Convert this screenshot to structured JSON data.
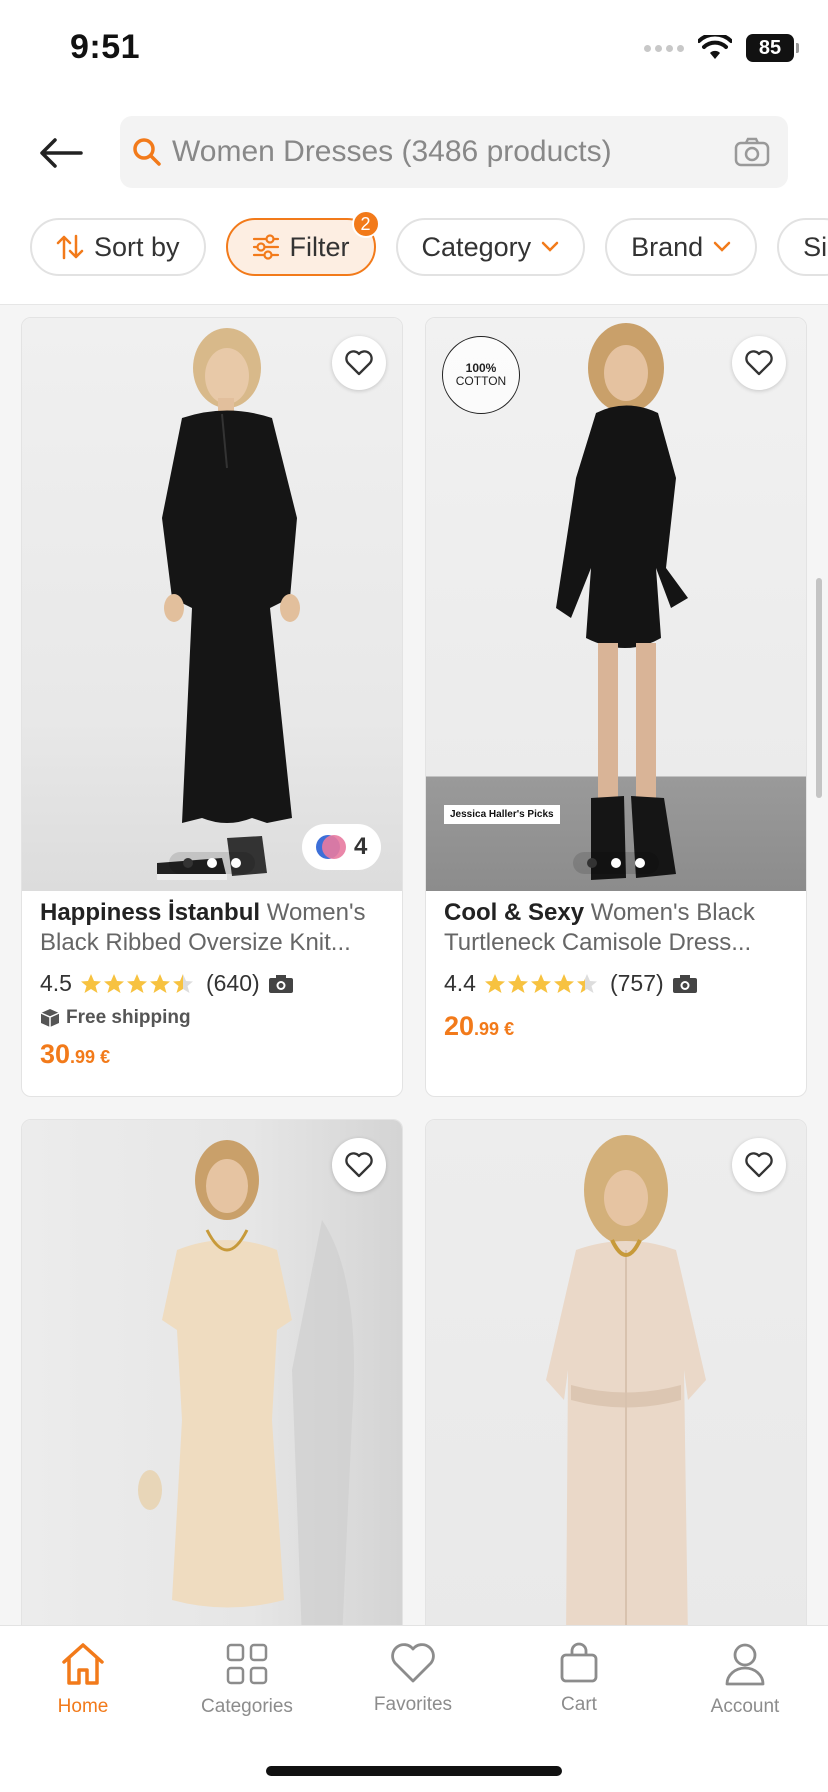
{
  "status_bar": {
    "time": "9:51",
    "battery": "85"
  },
  "header": {
    "search_text": "Women Dresses (3486 products)",
    "chips": [
      {
        "label": "Sort by",
        "icon": "sort-icon"
      },
      {
        "label": "Filter",
        "icon": "filter-icon",
        "badge": "2"
      },
      {
        "label": "Category",
        "icon": "chevron-down-icon"
      },
      {
        "label": "Brand",
        "icon": "chevron-down-icon"
      },
      {
        "label": "Si",
        "icon": ""
      }
    ]
  },
  "products": [
    {
      "brand": "Happiness İstanbul",
      "name": "Women's Black Ribbed Oversize Knit...",
      "rating": "4.5",
      "reviews": "(640)",
      "shipping": "Free shipping",
      "price_main": "30",
      "price_cents": ".99 €",
      "colors": "4"
    },
    {
      "brand": "Cool & Sexy",
      "name": "Women's Black Turtleneck Camisole Dress...",
      "rating": "4.4",
      "reviews": "(757)",
      "price_main": "20",
      "price_cents": ".99 €",
      "badge_top": "100%",
      "badge_bottom": "COTTON",
      "tag": "Jessica Haller's Picks"
    }
  ],
  "bottom_nav": [
    {
      "label": "Home",
      "icon": "home-icon",
      "active": true
    },
    {
      "label": "Categories",
      "icon": "grid-icon"
    },
    {
      "label": "Favorites",
      "icon": "heart-icon"
    },
    {
      "label": "Cart",
      "icon": "cart-icon"
    },
    {
      "label": "Account",
      "icon": "user-icon"
    }
  ],
  "colors": {
    "accent": "#f27a1a",
    "star": "#f7c240"
  }
}
